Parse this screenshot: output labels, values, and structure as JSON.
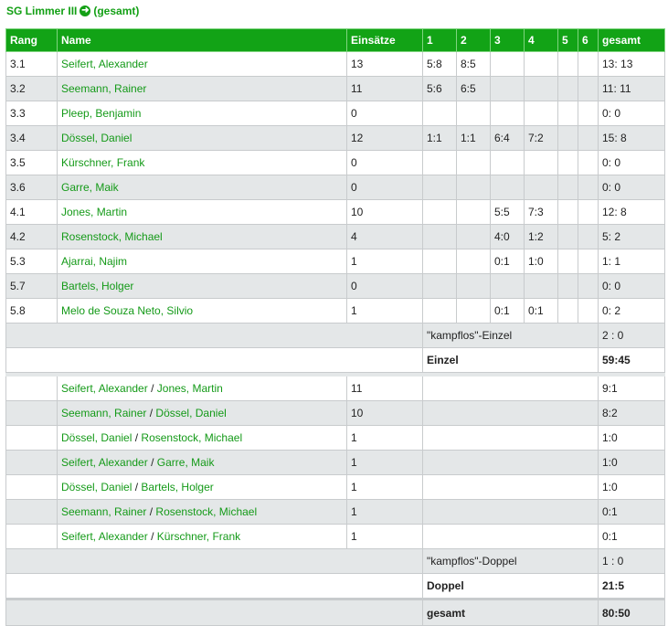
{
  "header": {
    "team": "SG Limmer III",
    "arrow_icon": "arrow-right-circle-icon",
    "suffix": "(gesamt)"
  },
  "columns": [
    "Rang",
    "Name",
    "Einsätze",
    "1",
    "2",
    "3",
    "4",
    "5",
    "6",
    "gesamt"
  ],
  "singles": [
    {
      "rang": "3.1",
      "name": "Seifert, Alexander",
      "einsaetze": "13",
      "r": [
        "5:8",
        "8:5",
        "",
        "",
        "",
        ""
      ],
      "gesamt": "13: 13"
    },
    {
      "rang": "3.2",
      "name": "Seemann, Rainer",
      "einsaetze": "11",
      "r": [
        "5:6",
        "6:5",
        "",
        "",
        "",
        ""
      ],
      "gesamt": "11: 11"
    },
    {
      "rang": "3.3",
      "name": "Pleep, Benjamin",
      "einsaetze": "0",
      "r": [
        "",
        "",
        "",
        "",
        "",
        ""
      ],
      "gesamt": "0: 0"
    },
    {
      "rang": "3.4",
      "name": "Dössel, Daniel",
      "einsaetze": "12",
      "r": [
        "1:1",
        "1:1",
        "6:4",
        "7:2",
        "",
        ""
      ],
      "gesamt": "15: 8"
    },
    {
      "rang": "3.5",
      "name": "Kürschner, Frank",
      "einsaetze": "0",
      "r": [
        "",
        "",
        "",
        "",
        "",
        ""
      ],
      "gesamt": "0: 0"
    },
    {
      "rang": "3.6",
      "name": "Garre, Maik",
      "einsaetze": "0",
      "r": [
        "",
        "",
        "",
        "",
        "",
        ""
      ],
      "gesamt": "0: 0"
    },
    {
      "rang": "4.1",
      "name": "Jones, Martin",
      "einsaetze": "10",
      "r": [
        "",
        "",
        "5:5",
        "7:3",
        "",
        ""
      ],
      "gesamt": "12: 8"
    },
    {
      "rang": "4.2",
      "name": "Rosenstock, Michael",
      "einsaetze": "4",
      "r": [
        "",
        "",
        "4:0",
        "1:2",
        "",
        ""
      ],
      "gesamt": "5: 2"
    },
    {
      "rang": "5.3",
      "name": "Ajarrai, Najim",
      "einsaetze": "1",
      "r": [
        "",
        "",
        "0:1",
        "1:0",
        "",
        ""
      ],
      "gesamt": "1: 1"
    },
    {
      "rang": "5.7",
      "name": "Bartels, Holger",
      "einsaetze": "0",
      "r": [
        "",
        "",
        "",
        "",
        "",
        ""
      ],
      "gesamt": "0: 0"
    },
    {
      "rang": "5.8",
      "name": "Melo de Souza Neto, Silvio",
      "einsaetze": "1",
      "r": [
        "",
        "",
        "0:1",
        "0:1",
        "",
        ""
      ],
      "gesamt": "0: 2"
    }
  ],
  "singles_summary": {
    "kampflos_label": "\"kampflos\"-Einzel",
    "kampflos_value": "2 : 0",
    "total_label": "Einzel",
    "total_value": "59:45"
  },
  "doubles": [
    {
      "p1": "Seifert, Alexander",
      "p2": "Jones, Martin",
      "einsaetze": "11",
      "gesamt": "9:1"
    },
    {
      "p1": "Seemann, Rainer",
      "p2": "Dössel, Daniel",
      "einsaetze": "10",
      "gesamt": "8:2"
    },
    {
      "p1": "Dössel, Daniel",
      "p2": "Rosenstock, Michael",
      "einsaetze": "1",
      "gesamt": "1:0"
    },
    {
      "p1": "Seifert, Alexander",
      "p2": "Garre, Maik",
      "einsaetze": "1",
      "gesamt": "1:0"
    },
    {
      "p1": "Dössel, Daniel",
      "p2": "Bartels, Holger",
      "einsaetze": "1",
      "gesamt": "1:0"
    },
    {
      "p1": "Seemann, Rainer",
      "p2": "Rosenstock, Michael",
      "einsaetze": "1",
      "gesamt": "0:1"
    },
    {
      "p1": "Seifert, Alexander",
      "p2": "Kürschner, Frank",
      "einsaetze": "1",
      "gesamt": "0:1"
    }
  ],
  "doubles_separator": "/",
  "doubles_summary": {
    "kampflos_label": "\"kampflos\"-Doppel",
    "kampflos_value": "1 : 0",
    "total_label": "Doppel",
    "total_value": "21:5"
  },
  "grand_total": {
    "label": "gesamt",
    "value": "80:50"
  },
  "colors": {
    "header_bg": "#12a316",
    "link": "#149a18",
    "row_alt": "#e4e7e8"
  }
}
